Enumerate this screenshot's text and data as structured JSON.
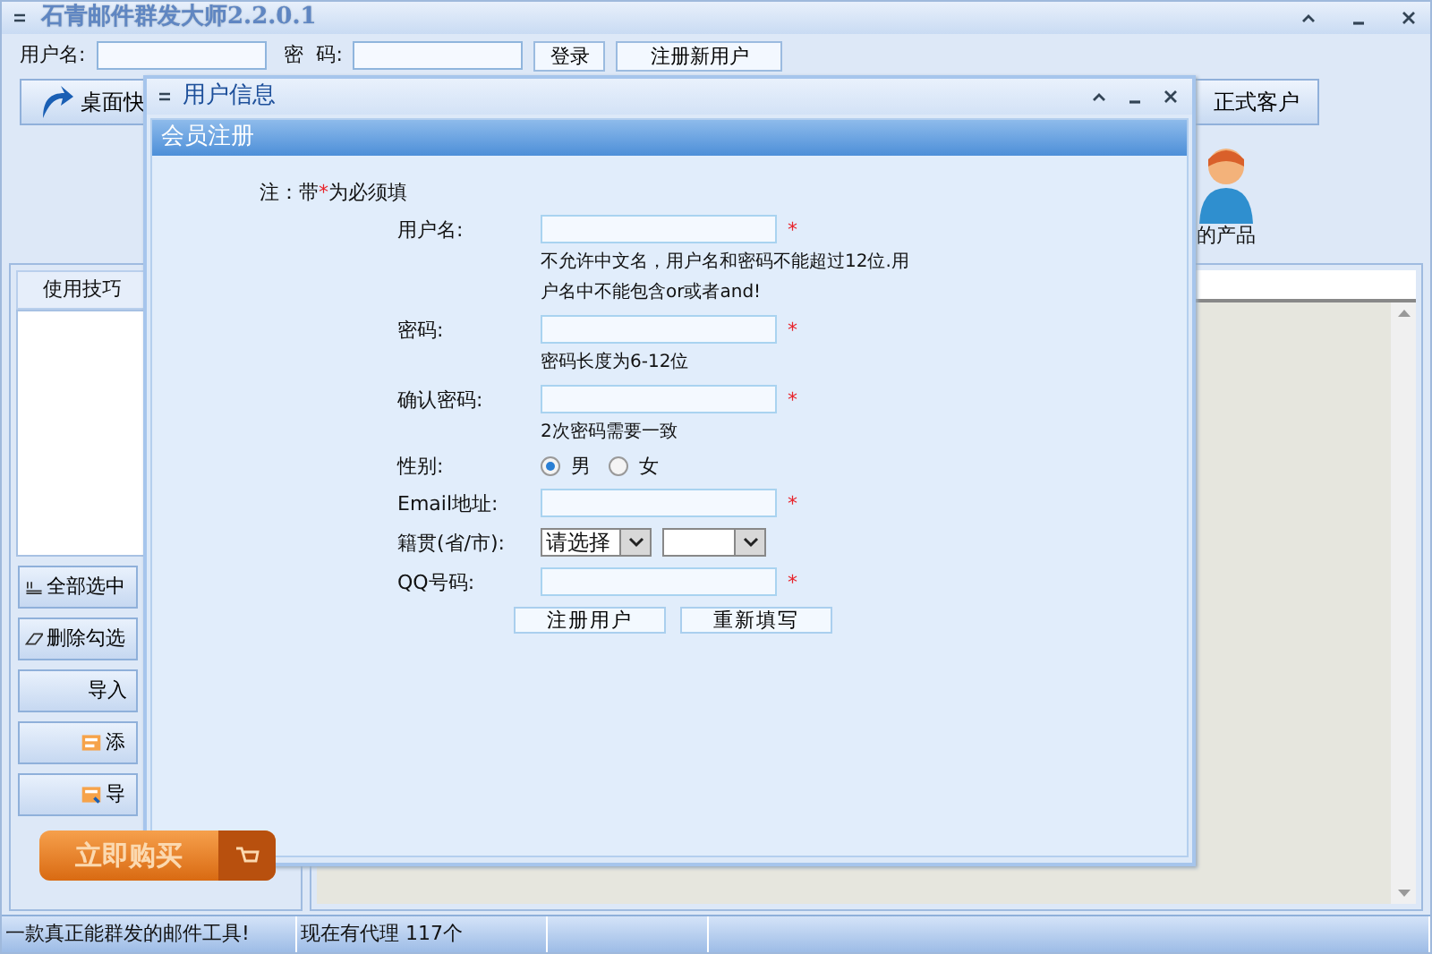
{
  "main_window": {
    "title": "石青邮件群发大师2.2.0.1"
  },
  "login": {
    "username_label": "用户名:",
    "password_label": "密  码:",
    "buttons": [
      "登录",
      "注册新用户"
    ]
  },
  "toolbar": [
    {
      "label": "桌面快",
      "kind": "shortcut"
    },
    {
      "label": "正式客户",
      "kind": "plain"
    }
  ],
  "product": {
    "label": "的产品"
  },
  "tips": {
    "title": "使用技巧"
  },
  "side_buttons": [
    {
      "label": "全部选中",
      "kind": "select-all"
    },
    {
      "label": "删除勾选",
      "kind": "erase"
    },
    {
      "label": "导入",
      "kind": "plain"
    },
    {
      "label": "添",
      "kind": "add"
    },
    {
      "label": "导",
      "kind": "export"
    }
  ],
  "buy_button": {
    "label": "立即购买"
  },
  "status_bar": [
    "一款真正能群发的邮件工具!",
    "现在有代理 117个"
  ],
  "dialog": {
    "title": "用户信息",
    "header": "会员注册",
    "note": {
      "prefix": "注：带",
      "star": "*",
      "suffix": "为必须填"
    },
    "fields": [
      {
        "label": "用户名:",
        "kind": "text",
        "required_mark": "*",
        "hints": [
          "不允许中文名，用户名和密码不能超过12位.用",
          "户名中不能包含or或者and!"
        ]
      },
      {
        "label": "密码:",
        "kind": "text",
        "required_mark": "*",
        "hints": [
          "密码长度为6-12位"
        ]
      },
      {
        "label": "确认密码:",
        "kind": "text",
        "required_mark": "*",
        "hints": [
          "2次密码需要一致"
        ]
      },
      {
        "label": "性别:",
        "kind": "radio",
        "options": [
          {
            "label": "男",
            "selected": true
          },
          {
            "label": "女",
            "selected": false
          }
        ]
      },
      {
        "label": "Email地址:",
        "kind": "text",
        "required_mark": "*"
      },
      {
        "label": "籍贯(省/市):",
        "kind": "select",
        "selects": [
          {
            "kind": "chosen",
            "value": "请选择"
          },
          {
            "kind": "blank"
          }
        ]
      },
      {
        "label": "QQ号码:",
        "kind": "text",
        "required_mark": "*"
      }
    ],
    "buttons": [
      "注册用户",
      "重新填写"
    ]
  }
}
